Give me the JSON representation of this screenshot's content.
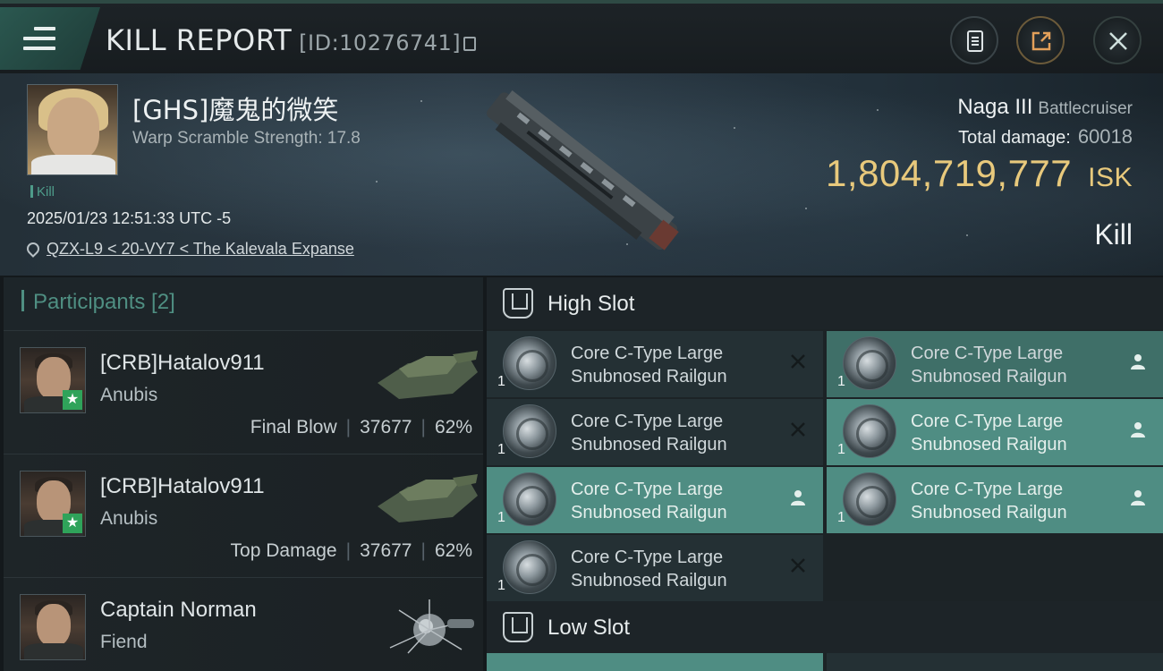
{
  "header": {
    "title": "KILL REPORT",
    "report_id": "[ID:10276741]"
  },
  "victim": {
    "name": "[GHS]魔鬼的微笑",
    "warp_scramble": "Warp Scramble Strength: 17.8",
    "tag": "Kill",
    "datetime": "2025/01/23 12:51:33 UTC -5",
    "location": "QZX-L9 < 20-VY7 < The Kalevala Expanse"
  },
  "ship": {
    "name": "Naga III",
    "class": "Battlecruiser",
    "total_damage_label": "Total damage:",
    "total_damage_value": "60018",
    "isk_value": "1,804,719,777",
    "isk_unit": "ISK",
    "result": "Kill"
  },
  "participants": {
    "header": "Participants [2]",
    "rows": [
      {
        "name": "[CRB]Hatalov911",
        "ship": "Anubis",
        "stat_label": "Final Blow",
        "damage": "37677",
        "percent": "62%",
        "badge": true
      },
      {
        "name": "[CRB]Hatalov911",
        "ship": "Anubis",
        "stat_label": "Top Damage",
        "damage": "37677",
        "percent": "62%",
        "badge": true
      },
      {
        "name": "Captain Norman",
        "ship": "Fiend",
        "badge": false
      }
    ]
  },
  "fitting": {
    "high_slot_label": "High Slot",
    "low_slot_label": "Low Slot",
    "modules": [
      {
        "line1": "Core C-Type Large",
        "line2": "Snubnosed Railgun",
        "qty": "1",
        "status": "destroyed"
      },
      {
        "line1": "Core C-Type Large",
        "line2": "Snubnosed Railgun",
        "qty": "1",
        "status": "dropped"
      },
      {
        "line1": "Core C-Type Large",
        "line2": "Snubnosed Railgun",
        "qty": "1",
        "status": "destroyed"
      },
      {
        "line1": "Core C-Type Large",
        "line2": "Snubnosed Railgun",
        "qty": "1",
        "status": "dropped"
      },
      {
        "line1": "Core C-Type Large",
        "line2": "Snubnosed Railgun",
        "qty": "1",
        "status": "dropped"
      },
      {
        "line1": "Core C-Type Large",
        "line2": "Snubnosed Railgun",
        "qty": "1",
        "status": "dropped"
      },
      {
        "line1": "Core C-Type Large",
        "line2": "Snubnosed Railgun",
        "qty": "1",
        "status": "destroyed"
      }
    ]
  },
  "icons": {
    "menu": "hamburger-icon",
    "copy": "copy-icon",
    "clipboard": "clipboard-icon",
    "share": "share-icon",
    "close": "close-icon",
    "location": "map-pin-icon",
    "slot": "slot-icon",
    "destroyed": "x-icon",
    "dropped": "person-icon"
  },
  "colors": {
    "accent_teal": "#4f8d83",
    "isk_gold": "#e8c97c",
    "badge_green": "#2fa35a"
  }
}
